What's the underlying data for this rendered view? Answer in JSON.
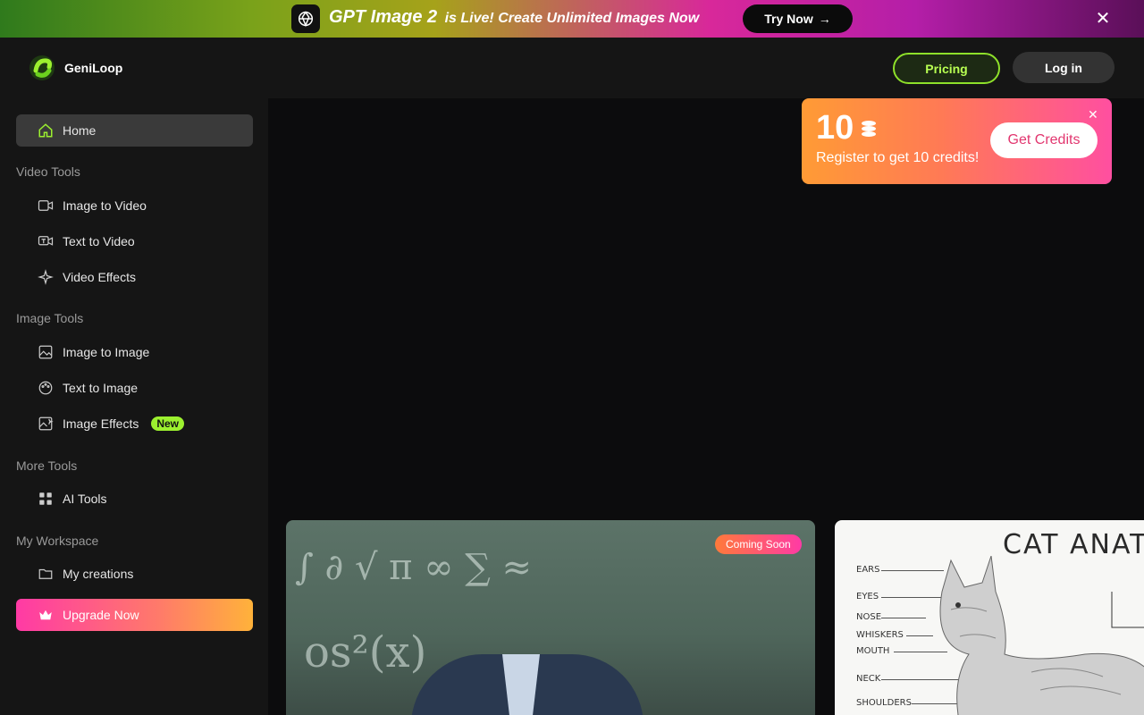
{
  "banner": {
    "headline": "GPT Image 2",
    "text": "is Live! Create Unlimited Images Now",
    "cta": "Try Now",
    "logo_icon": "openai-icon",
    "close_icon": "close-icon"
  },
  "header": {
    "brand": "GeniLoop",
    "pricing": "Pricing",
    "login": "Log in"
  },
  "sidebar": {
    "home": "Home",
    "sections": [
      {
        "title": "Video Tools",
        "items": [
          "Image to Video",
          "Text to Video",
          "Video Effects"
        ]
      },
      {
        "title": "Image Tools",
        "items": [
          "Image to Image",
          "Text to Image",
          "Image Effects"
        ]
      },
      {
        "title": "More Tools",
        "items": [
          "AI Tools"
        ]
      },
      {
        "title": "My Workspace",
        "items": [
          "My creations"
        ]
      }
    ],
    "new_badge": "New",
    "upgrade": "Upgrade Now"
  },
  "credits": {
    "amount": "10",
    "subtitle": "Register to get 10 credits!",
    "cta": "Get Credits"
  },
  "cards": {
    "video_badge": "Coming Soon",
    "cat_title": "CAT ANATOMY",
    "cat_labels": [
      "EARS",
      "EYES",
      "NOSE",
      "WHISKERS",
      "MOUTH",
      "NECK",
      "SHOULDERS"
    ]
  },
  "colors": {
    "accent_green": "#8ee02a",
    "pink": "#ff3aa5",
    "orange": "#ff9b35"
  }
}
